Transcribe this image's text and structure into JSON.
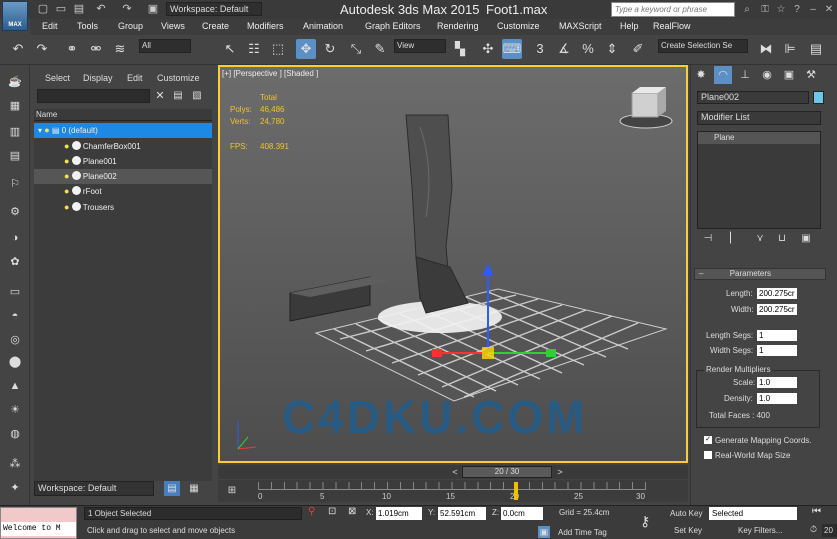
{
  "app": {
    "logo_text": "MAX",
    "title": "Autodesk 3ds Max  2015",
    "filename": "Foot1.max",
    "workspace": "Workspace: Default",
    "search_placeholder": "Type a keyword or phrase"
  },
  "menus": [
    "Edit",
    "Tools",
    "Group",
    "Views",
    "Create",
    "Modifiers",
    "Animation",
    "Graph Editors",
    "Rendering",
    "Customize",
    "MAXScript",
    "Help",
    "RealFlow"
  ],
  "toolbar": {
    "selection_filter": "All",
    "ref_coord": "View",
    "named_selection": "Create Selection Se",
    "snap_3": "3",
    "snap_percent": "%"
  },
  "scene_explorer": {
    "menus": [
      "Select",
      "Display",
      "Edit",
      "Customize"
    ],
    "column_name": "Name",
    "rows": [
      {
        "label": "0 (default)",
        "state": "selected"
      },
      {
        "label": "ChamferBox001",
        "state": "normal"
      },
      {
        "label": "Plane001",
        "state": "normal"
      },
      {
        "label": "Plane002",
        "state": "alt"
      },
      {
        "label": "rFoot",
        "state": "normal"
      },
      {
        "label": "Trousers",
        "state": "normal"
      }
    ],
    "workspace": "Workspace: Default"
  },
  "viewport": {
    "label": "[+] [Perspective ] [Shaded ]",
    "stats_header": "Total",
    "polys_label": "Polys:",
    "polys_value": "46,486",
    "verts_label": "Verts:",
    "verts_value": "24,780",
    "fps_label": "FPS:",
    "fps_value": "408.391",
    "watermark": "C4DKU.COM"
  },
  "command_panel": {
    "object_name": "Plane002",
    "object_color": "#6ec6e8",
    "modifier_list": "Modifier List",
    "stack_item": "Plane",
    "parameters_title": "Parameters",
    "length_label": "Length:",
    "length_value": "200.275cr",
    "width_label": "Width:",
    "width_value": "200.275cr",
    "length_segs_label": "Length Segs:",
    "length_segs_value": "1",
    "width_segs_label": "Width Segs:",
    "width_segs_value": "1",
    "render_multipliers": "Render Multipliers",
    "scale_label": "Scale:",
    "scale_value": "1.0",
    "density_label": "Density:",
    "density_value": "1.0",
    "total_faces": "Total Faces : 400",
    "gen_mapping": "Generate Mapping Coords.",
    "real_world": "Real-World Map Size"
  },
  "timeline": {
    "frame": "20 / 30",
    "ticks": [
      "0",
      "5",
      "10",
      "15",
      "20",
      "25",
      "30"
    ]
  },
  "status": {
    "welcome": "Welcome to M",
    "selected": "1 Object Selected",
    "prompt": "Click and drag to select and move objects",
    "x_label": "X:",
    "x_value": "1.019cm",
    "y_label": "Y:",
    "y_value": "52.591cm",
    "z_label": "Z:",
    "z_value": "0.0cm",
    "grid": "Grid = 25.4cm",
    "add_time_tag": "Add Time Tag",
    "auto_key": "Auto Key",
    "set_key": "Set Key",
    "selected_dd": "Selected",
    "key_filters": "Key Filters...",
    "frame_field": "20"
  }
}
